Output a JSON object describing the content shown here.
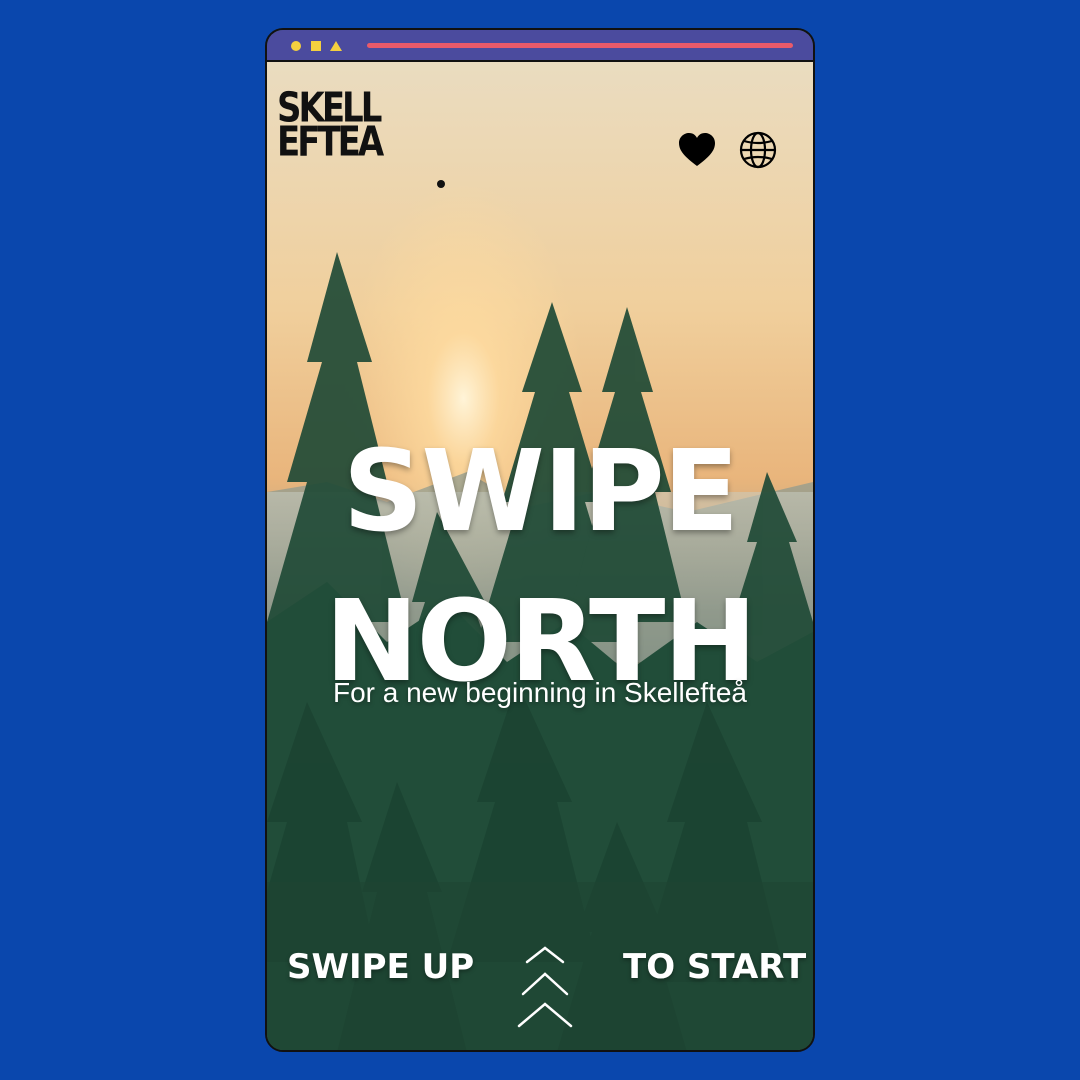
{
  "logo": {
    "line1": "SKELL",
    "line2": "EFTEA"
  },
  "hero": {
    "title_line1": "SWIPE",
    "title_line2": "NORTH",
    "subtitle": "For a new beginning in Skellefteå"
  },
  "cta": {
    "left": "SWIPE UP",
    "right": "TO START"
  },
  "icons": {
    "favorite": "heart-icon",
    "language": "globe-icon",
    "swipe": "chevron-up-icon"
  },
  "colors": {
    "background": "#0a47ad",
    "window_bar": "#4b4b9e",
    "url_bar": "#ea5a6a",
    "window_dots": "#f4d03f"
  }
}
